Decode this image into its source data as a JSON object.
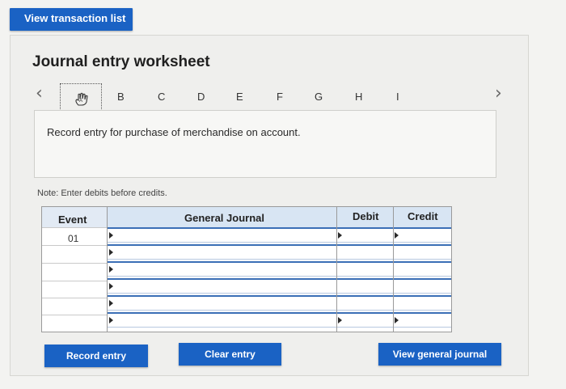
{
  "top_button": "View transaction list",
  "title": "Journal entry worksheet",
  "tabs": [
    "B",
    "C",
    "D",
    "E",
    "F",
    "G",
    "H",
    "I"
  ],
  "description": "Record entry for purchase of merchandise on account.",
  "note": "Note: Enter debits before credits.",
  "table": {
    "headers": {
      "event": "Event",
      "journal": "General Journal",
      "debit": "Debit",
      "credit": "Credit"
    },
    "event_value": "01"
  },
  "buttons": {
    "record": "Record entry",
    "clear": "Clear entry",
    "view_journal": "View general journal"
  }
}
